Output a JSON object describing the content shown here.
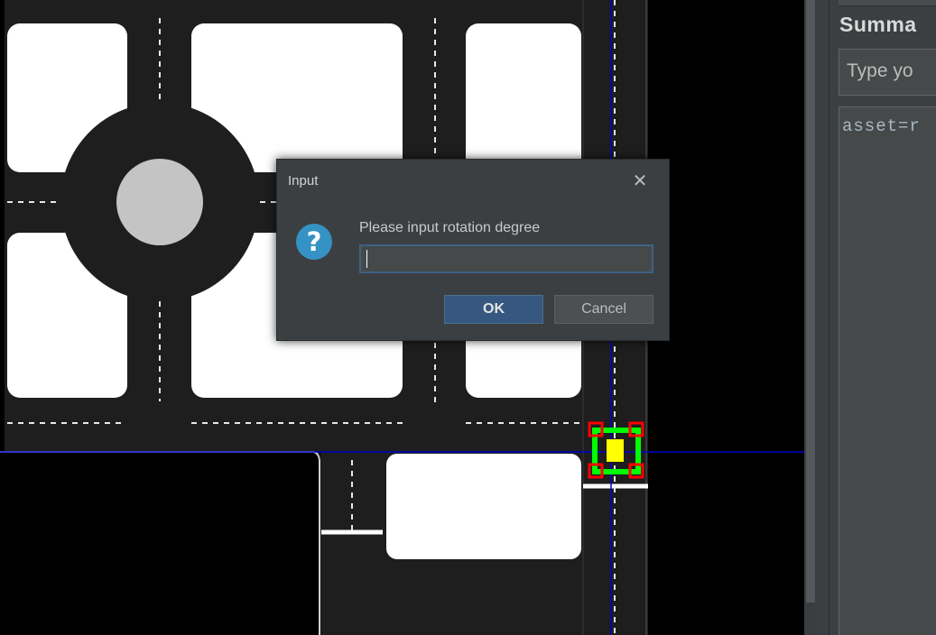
{
  "sidebar": {
    "summary_title": "Summa",
    "summary_placeholder": "Type yo",
    "summary_text": "asset=r"
  },
  "dialog": {
    "title": "Input",
    "icon": "question-icon",
    "close_icon": "close-icon",
    "message": "Please input rotation degree",
    "value": "",
    "ok_label": "OK",
    "cancel_label": "Cancel"
  },
  "colors": {
    "road": "#1e1e1e",
    "block": "#ffffff",
    "guide_line": "#0000cc",
    "selection_box": "#00ff00",
    "selected_vehicle": "#ffff00",
    "handle": "#ff0000",
    "accent_button": "#365880"
  }
}
